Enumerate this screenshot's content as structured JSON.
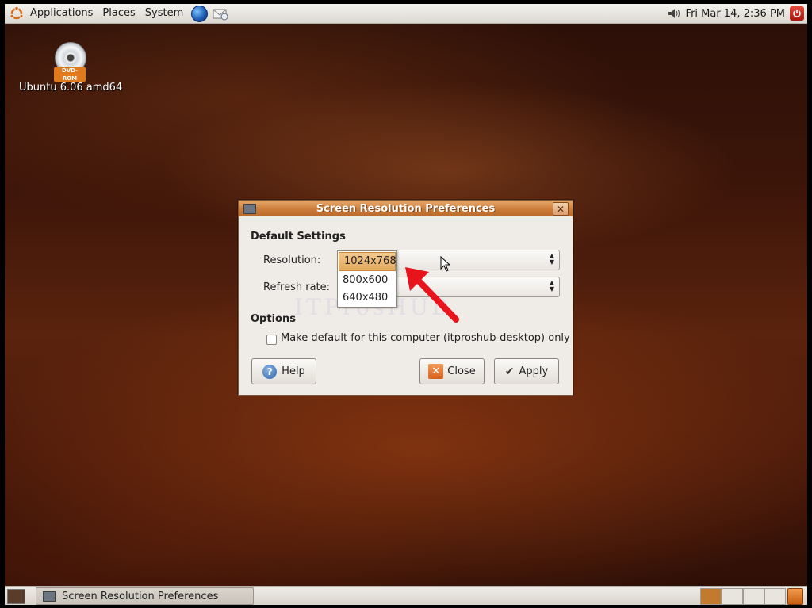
{
  "top_panel": {
    "menus": [
      "Applications",
      "Places",
      "System"
    ],
    "clock": "Fri Mar 14,  2:36 PM"
  },
  "desktop": {
    "icon_label": "Ubuntu 6.06 amd64",
    "icon_badge": "DVD-ROM"
  },
  "dialog": {
    "title": "Screen Resolution Preferences",
    "default_settings_heading": "Default Settings",
    "resolution_label": "Resolution:",
    "refresh_label": "Refresh rate:",
    "resolution_options": [
      "1024x768",
      "800x600",
      "640x480"
    ],
    "selected_resolution": "1024x768",
    "options_heading": "Options",
    "make_default_label": "Make default for this computer (itproshub-desktop) only",
    "make_default_checked": false,
    "buttons": {
      "help": "Help",
      "close": "Close",
      "apply": "Apply"
    }
  },
  "bottom_panel": {
    "task_label": "Screen Resolution Preferences"
  },
  "colors": {
    "accent": "#c97a37",
    "annotation_arrow": "#e8141b"
  }
}
